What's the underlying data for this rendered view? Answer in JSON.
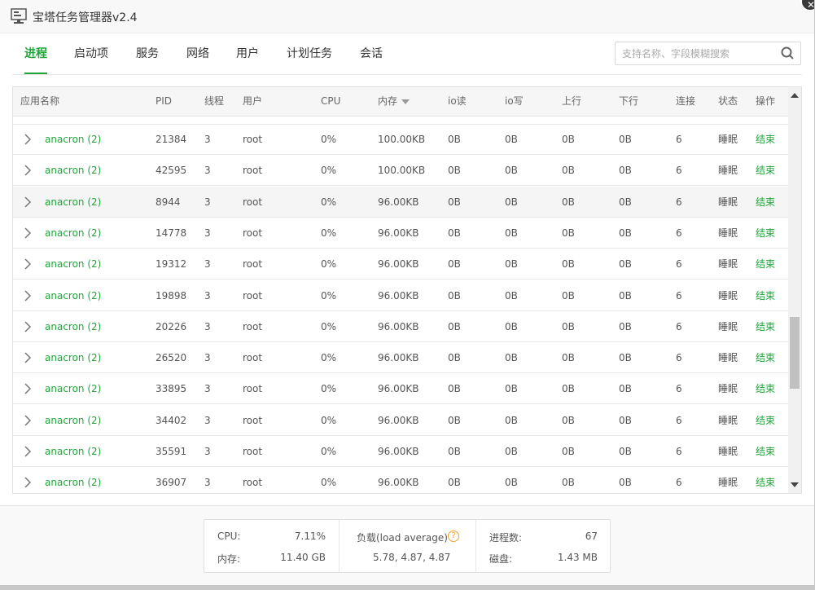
{
  "window": {
    "title": "宝塔任务管理器v2.4"
  },
  "tabs": [
    {
      "label": "进程",
      "active": true
    },
    {
      "label": "启动项"
    },
    {
      "label": "服务"
    },
    {
      "label": "网络"
    },
    {
      "label": "用户"
    },
    {
      "label": "计划任务"
    },
    {
      "label": "会话"
    }
  ],
  "search": {
    "placeholder": "支持名称、字段模糊搜索",
    "value": ""
  },
  "table": {
    "headers": {
      "name": "应用名称",
      "pid": "PID",
      "threads": "线程",
      "user": "用户",
      "cpu": "CPU",
      "mem": "内存",
      "io_read": "io读",
      "io_write": "io写",
      "up": "上行",
      "down": "下行",
      "conn": "连接",
      "status": "状态",
      "action": "操作"
    },
    "sorted_by": "mem",
    "rows": [
      {
        "name": "anacron (2)",
        "pid": "21384",
        "threads": "3",
        "user": "root",
        "cpu": "0%",
        "mem": "100.00KB",
        "io_read": "0B",
        "io_write": "0B",
        "up": "0B",
        "down": "0B",
        "conn": "6",
        "status": "睡眠",
        "action": "结束"
      },
      {
        "name": "anacron (2)",
        "pid": "42595",
        "threads": "3",
        "user": "root",
        "cpu": "0%",
        "mem": "100.00KB",
        "io_read": "0B",
        "io_write": "0B",
        "up": "0B",
        "down": "0B",
        "conn": "6",
        "status": "睡眠",
        "action": "结束"
      },
      {
        "name": "anacron (2)",
        "pid": "8944",
        "threads": "3",
        "user": "root",
        "cpu": "0%",
        "mem": "96.00KB",
        "io_read": "0B",
        "io_write": "0B",
        "up": "0B",
        "down": "0B",
        "conn": "6",
        "status": "睡眠",
        "action": "结束",
        "hover": true
      },
      {
        "name": "anacron (2)",
        "pid": "14778",
        "threads": "3",
        "user": "root",
        "cpu": "0%",
        "mem": "96.00KB",
        "io_read": "0B",
        "io_write": "0B",
        "up": "0B",
        "down": "0B",
        "conn": "6",
        "status": "睡眠",
        "action": "结束"
      },
      {
        "name": "anacron (2)",
        "pid": "19312",
        "threads": "3",
        "user": "root",
        "cpu": "0%",
        "mem": "96.00KB",
        "io_read": "0B",
        "io_write": "0B",
        "up": "0B",
        "down": "0B",
        "conn": "6",
        "status": "睡眠",
        "action": "结束"
      },
      {
        "name": "anacron (2)",
        "pid": "19898",
        "threads": "3",
        "user": "root",
        "cpu": "0%",
        "mem": "96.00KB",
        "io_read": "0B",
        "io_write": "0B",
        "up": "0B",
        "down": "0B",
        "conn": "6",
        "status": "睡眠",
        "action": "结束"
      },
      {
        "name": "anacron (2)",
        "pid": "20226",
        "threads": "3",
        "user": "root",
        "cpu": "0%",
        "mem": "96.00KB",
        "io_read": "0B",
        "io_write": "0B",
        "up": "0B",
        "down": "0B",
        "conn": "6",
        "status": "睡眠",
        "action": "结束"
      },
      {
        "name": "anacron (2)",
        "pid": "26520",
        "threads": "3",
        "user": "root",
        "cpu": "0%",
        "mem": "96.00KB",
        "io_read": "0B",
        "io_write": "0B",
        "up": "0B",
        "down": "0B",
        "conn": "6",
        "status": "睡眠",
        "action": "结束"
      },
      {
        "name": "anacron (2)",
        "pid": "33895",
        "threads": "3",
        "user": "root",
        "cpu": "0%",
        "mem": "96.00KB",
        "io_read": "0B",
        "io_write": "0B",
        "up": "0B",
        "down": "0B",
        "conn": "6",
        "status": "睡眠",
        "action": "结束"
      },
      {
        "name": "anacron (2)",
        "pid": "34402",
        "threads": "3",
        "user": "root",
        "cpu": "0%",
        "mem": "96.00KB",
        "io_read": "0B",
        "io_write": "0B",
        "up": "0B",
        "down": "0B",
        "conn": "6",
        "status": "睡眠",
        "action": "结束"
      },
      {
        "name": "anacron (2)",
        "pid": "35591",
        "threads": "3",
        "user": "root",
        "cpu": "0%",
        "mem": "96.00KB",
        "io_read": "0B",
        "io_write": "0B",
        "up": "0B",
        "down": "0B",
        "conn": "6",
        "status": "睡眠",
        "action": "结束"
      },
      {
        "name": "anacron (2)",
        "pid": "36907",
        "threads": "3",
        "user": "root",
        "cpu": "0%",
        "mem": "96.00KB",
        "io_read": "0B",
        "io_write": "0B",
        "up": "0B",
        "down": "0B",
        "conn": "6",
        "status": "睡眠",
        "action": "结束"
      }
    ]
  },
  "footer": {
    "cpu_label": "CPU:",
    "cpu_value": "7.11%",
    "mem_label": "内存:",
    "mem_value": "11.40 GB",
    "load_label": "负载(load average)",
    "load_value": "5.78, 4.87, 4.87",
    "proc_label": "进程数:",
    "proc_value": "67",
    "disk_label": "磁盘:",
    "disk_value": "1.43 MB"
  },
  "colors": {
    "accent": "#20a53a",
    "help": "#f0a030"
  }
}
